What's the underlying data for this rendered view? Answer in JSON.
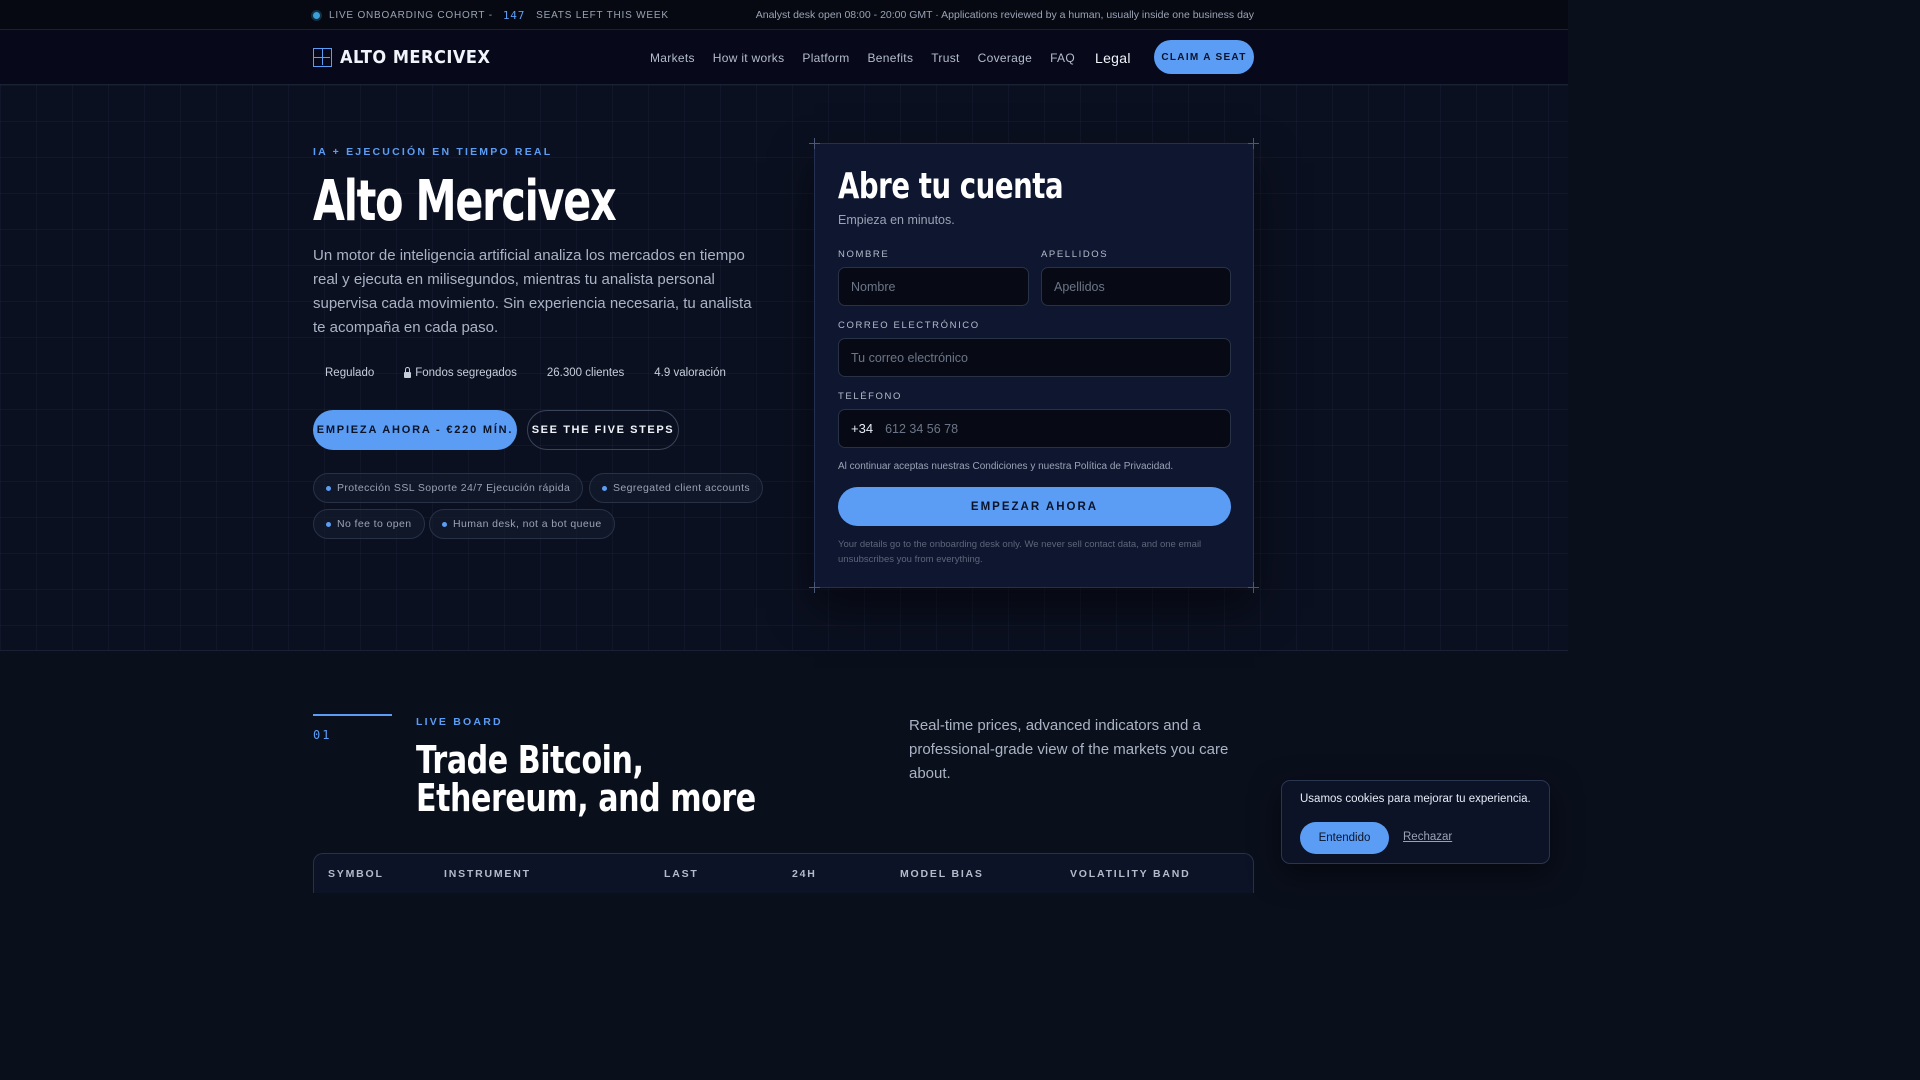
{
  "topbar": {
    "cohort_label": "LIVE ONBOARDING COHORT -",
    "seats_count": "147",
    "seats_label": "SEATS LEFT THIS WEEK",
    "desk_hours": "Analyst desk open 08:00 - 20:00 GMT · Applications reviewed by a human, usually inside one business day"
  },
  "nav": {
    "brand": "ALTO MERCIVEX",
    "links": [
      "Markets",
      "How it works",
      "Platform",
      "Benefits",
      "Trust",
      "Coverage",
      "FAQ"
    ],
    "legal": "Legal",
    "cta": "CLAIM A SEAT"
  },
  "hero": {
    "eyebrow": "IA + EJECUCIÓN EN TIEMPO REAL",
    "title": "Alto Mercivex",
    "description": "Un motor de inteligencia artificial analiza los mercados en tiempo real y ejecuta en milisegundos, mientras tu analista personal supervisa cada movimiento. Sin experiencia necesaria, tu analista te acompaña en cada paso.",
    "stats": [
      "Regulado",
      "Fondos segregados",
      "26.300 clientes",
      "4.9  valoración"
    ],
    "cta_primary": "EMPIEZA AHORA - €220 MÍN.",
    "cta_secondary": "SEE THE FIVE STEPS",
    "chips": [
      "Protección SSL  Soporte 24/7  Ejecución rápida",
      "Segregated client accounts",
      "No fee to open",
      "Human desk, not a bot queue"
    ]
  },
  "form": {
    "title": "Abre tu cuenta",
    "subtitle": "Empieza en minutos.",
    "first_name_label": "NOMBRE",
    "first_name_placeholder": "Nombre",
    "last_name_label": "APELLIDOS",
    "last_name_placeholder": "Apellidos",
    "email_label": "CORREO ELECTRÓNICO",
    "email_placeholder": "Tu correo electrónico",
    "phone_label": "TELÉFONO",
    "phone_prefix": "+34",
    "phone_placeholder": "612 34 56 78",
    "terms": "Al continuar aceptas nuestras Condiciones y nuestra Política de Privacidad.",
    "submit": "EMPEZAR AHORA",
    "fine_print": "Your details go to the onboarding desk only. We never sell contact data, and one email unsubscribes you from everything."
  },
  "section2": {
    "number": "01",
    "eyebrow": "LIVE BOARD",
    "title": "Trade Bitcoin, Ethereum, and more",
    "description": "Real-time prices, advanced indicators and a professional-grade view of the markets you care about.",
    "table_headers": [
      "SYMBOL",
      "INSTRUMENT",
      "LAST",
      "24H",
      "MODEL BIAS",
      "VOLATILITY BAND"
    ]
  },
  "cookie": {
    "text": "Usamos cookies para mejorar tu experiencia.",
    "accept": "Entendido",
    "reject": "Rechazar"
  },
  "colors": {
    "accent": "#5b9df5",
    "background": "#0b1020",
    "card": "#0e1630"
  }
}
